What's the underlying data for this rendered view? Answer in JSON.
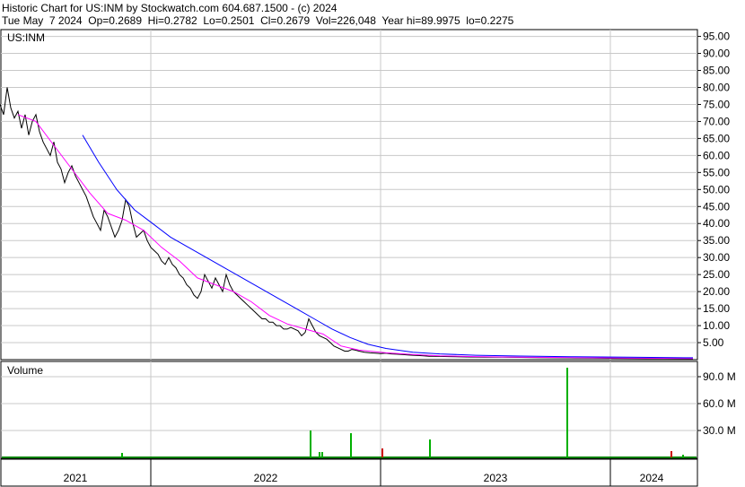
{
  "header": {
    "line1": "Historic Chart for US:INM by Stockwatch.com 604.687.1500 - (c) 2024",
    "line2": "Tue May  7 2024  Op=0.2689  Hi=0.2782  Lo=0.2501  Cl=0.2679  Vol=226,048  Year hi=89.9975  lo=0.2275"
  },
  "chart_data": [
    {
      "type": "line",
      "title": "US:INM",
      "x_labels": [
        "2021",
        "2022",
        "2023",
        "2024"
      ],
      "y_ticks": [
        "95.00",
        "90.00",
        "85.00",
        "80.00",
        "75.00",
        "70.00",
        "65.00",
        "60.00",
        "55.00",
        "50.00",
        "45.00",
        "40.00",
        "35.00",
        "30.00",
        "25.00",
        "20.00",
        "15.00",
        "10.00",
        "5.00"
      ],
      "ylim": [
        0,
        97
      ],
      "grid": true,
      "series": [
        {
          "style": "price",
          "color": "#000000",
          "points": [
            [
              0,
              75
            ],
            [
              4,
              72
            ],
            [
              8,
              80
            ],
            [
              12,
              74
            ],
            [
              16,
              71
            ],
            [
              20,
              73
            ],
            [
              24,
              68
            ],
            [
              28,
              72
            ],
            [
              32,
              66
            ],
            [
              36,
              70
            ],
            [
              40,
              72
            ],
            [
              44,
              67
            ],
            [
              48,
              64
            ],
            [
              52,
              62
            ],
            [
              56,
              60
            ],
            [
              60,
              64
            ],
            [
              64,
              58
            ],
            [
              68,
              56
            ],
            [
              72,
              52
            ],
            [
              76,
              55
            ],
            [
              80,
              57
            ],
            [
              84,
              54
            ],
            [
              88,
              52
            ],
            [
              92,
              50
            ],
            [
              96,
              48
            ],
            [
              100,
              45
            ],
            [
              104,
              42
            ],
            [
              108,
              40
            ],
            [
              112,
              38
            ],
            [
              116,
              44
            ],
            [
              120,
              42
            ],
            [
              124,
              39
            ],
            [
              128,
              36
            ],
            [
              132,
              38
            ],
            [
              136,
              41
            ],
            [
              140,
              47
            ],
            [
              144,
              45
            ],
            [
              148,
              40
            ],
            [
              152,
              36
            ],
            [
              156,
              37
            ],
            [
              160,
              38
            ],
            [
              164,
              35
            ],
            [
              168,
              33
            ],
            [
              172,
              32
            ],
            [
              176,
              31
            ],
            [
              180,
              29
            ],
            [
              184,
              28
            ],
            [
              188,
              30
            ],
            [
              192,
              28
            ],
            [
              196,
              27
            ],
            [
              200,
              25
            ],
            [
              204,
              24
            ],
            [
              208,
              22
            ],
            [
              212,
              21
            ],
            [
              216,
              19
            ],
            [
              220,
              18
            ],
            [
              224,
              20
            ],
            [
              228,
              25
            ],
            [
              232,
              23
            ],
            [
              236,
              21
            ],
            [
              240,
              24
            ],
            [
              244,
              22
            ],
            [
              248,
              20
            ],
            [
              252,
              25
            ],
            [
              256,
              22
            ],
            [
              260,
              20
            ],
            [
              264,
              19
            ],
            [
              268,
              18
            ],
            [
              272,
              17
            ],
            [
              276,
              16
            ],
            [
              280,
              15
            ],
            [
              284,
              14
            ],
            [
              288,
              13
            ],
            [
              292,
              12
            ],
            [
              296,
              12
            ],
            [
              300,
              11
            ],
            [
              304,
              11
            ],
            [
              308,
              10
            ],
            [
              312,
              10
            ],
            [
              316,
              9
            ],
            [
              320,
              9
            ],
            [
              324,
              9.5
            ],
            [
              328,
              9
            ],
            [
              332,
              8.5
            ],
            [
              336,
              7
            ],
            [
              340,
              8
            ],
            [
              344,
              12
            ],
            [
              348,
              10
            ],
            [
              352,
              8
            ],
            [
              356,
              7
            ],
            [
              360,
              6.5
            ],
            [
              364,
              6
            ],
            [
              368,
              5
            ],
            [
              372,
              4
            ],
            [
              376,
              3.5
            ],
            [
              380,
              3
            ],
            [
              384,
              2.5
            ],
            [
              388,
              2.5
            ],
            [
              392,
              3
            ],
            [
              396,
              2.8
            ],
            [
              400,
              2.5
            ],
            [
              406,
              2.2
            ],
            [
              412,
              2.0
            ],
            [
              418,
              1.9
            ],
            [
              424,
              1.8
            ],
            [
              430,
              1.9
            ],
            [
              436,
              1.7
            ],
            [
              442,
              1.6
            ],
            [
              448,
              1.5
            ],
            [
              454,
              1.4
            ],
            [
              460,
              1.3
            ],
            [
              466,
              1.2
            ],
            [
              472,
              1.1
            ],
            [
              478,
              1.0
            ],
            [
              484,
              1.0
            ],
            [
              500,
              0.9
            ],
            [
              520,
              0.8
            ],
            [
              540,
              0.75
            ],
            [
              560,
              0.7
            ],
            [
              580,
              0.65
            ],
            [
              600,
              0.6
            ],
            [
              620,
              0.55
            ],
            [
              640,
              0.5
            ],
            [
              660,
              0.45
            ],
            [
              680,
              0.4
            ],
            [
              700,
              0.38
            ],
            [
              720,
              0.35
            ],
            [
              740,
              0.32
            ],
            [
              760,
              0.3
            ],
            [
              772,
              0.27
            ]
          ]
        },
        {
          "style": "ma-short",
          "color": "#ff00ff",
          "points": [
            [
              20,
              72
            ],
            [
              40,
              70
            ],
            [
              60,
              63
            ],
            [
              80,
              56
            ],
            [
              100,
              49
            ],
            [
              120,
              43
            ],
            [
              140,
              41
            ],
            [
              160,
              38
            ],
            [
              180,
              33
            ],
            [
              200,
              29
            ],
            [
              220,
              24
            ],
            [
              240,
              22
            ],
            [
              260,
              20
            ],
            [
              280,
              17
            ],
            [
              300,
              13
            ],
            [
              320,
              10.5
            ],
            [
              340,
              9
            ],
            [
              360,
              7.5
            ],
            [
              380,
              4
            ],
            [
              400,
              2.8
            ],
            [
              430,
              2.0
            ],
            [
              460,
              1.5
            ],
            [
              490,
              1.1
            ],
            [
              530,
              0.9
            ],
            [
              580,
              0.75
            ],
            [
              640,
              0.6
            ],
            [
              700,
              0.45
            ],
            [
              772,
              0.35
            ]
          ]
        },
        {
          "style": "ma-long",
          "color": "#0000ff",
          "points": [
            [
              92,
              66
            ],
            [
              110,
              58
            ],
            [
              130,
              50
            ],
            [
              150,
              44
            ],
            [
              170,
              40
            ],
            [
              190,
              36
            ],
            [
              210,
              33
            ],
            [
              230,
              30
            ],
            [
              250,
              27
            ],
            [
              270,
              24
            ],
            [
              290,
              21
            ],
            [
              310,
              18
            ],
            [
              330,
              15
            ],
            [
              350,
              12
            ],
            [
              370,
              9
            ],
            [
              390,
              6.5
            ],
            [
              410,
              4.5
            ],
            [
              430,
              3.3
            ],
            [
              460,
              2.2
            ],
            [
              490,
              1.7
            ],
            [
              530,
              1.3
            ],
            [
              580,
              1.05
            ],
            [
              640,
              0.85
            ],
            [
              700,
              0.7
            ],
            [
              772,
              0.55
            ]
          ]
        }
      ]
    },
    {
      "type": "bar",
      "title": "Volume",
      "y_ticks": [
        "90.0 M",
        "60.0 M",
        "30.0 M"
      ],
      "ylim": [
        0,
        100
      ],
      "bars": [
        {
          "x": 136,
          "v": 5,
          "color": "#00b000"
        },
        {
          "x": 346,
          "v": 30,
          "color": "#00b000"
        },
        {
          "x": 356,
          "v": 6,
          "color": "#00b000"
        },
        {
          "x": 359,
          "v": 6,
          "color": "#00b000"
        },
        {
          "x": 391,
          "v": 27,
          "color": "#00b000"
        },
        {
          "x": 426,
          "v": 10,
          "color": "#cc0000"
        },
        {
          "x": 479,
          "v": 20,
          "color": "#00b000"
        },
        {
          "x": 632,
          "v": 100,
          "color": "#00b000"
        },
        {
          "x": 748,
          "v": 7,
          "color": "#cc0000"
        },
        {
          "x": 761,
          "v": 3,
          "color": "#00b000"
        }
      ]
    }
  ]
}
